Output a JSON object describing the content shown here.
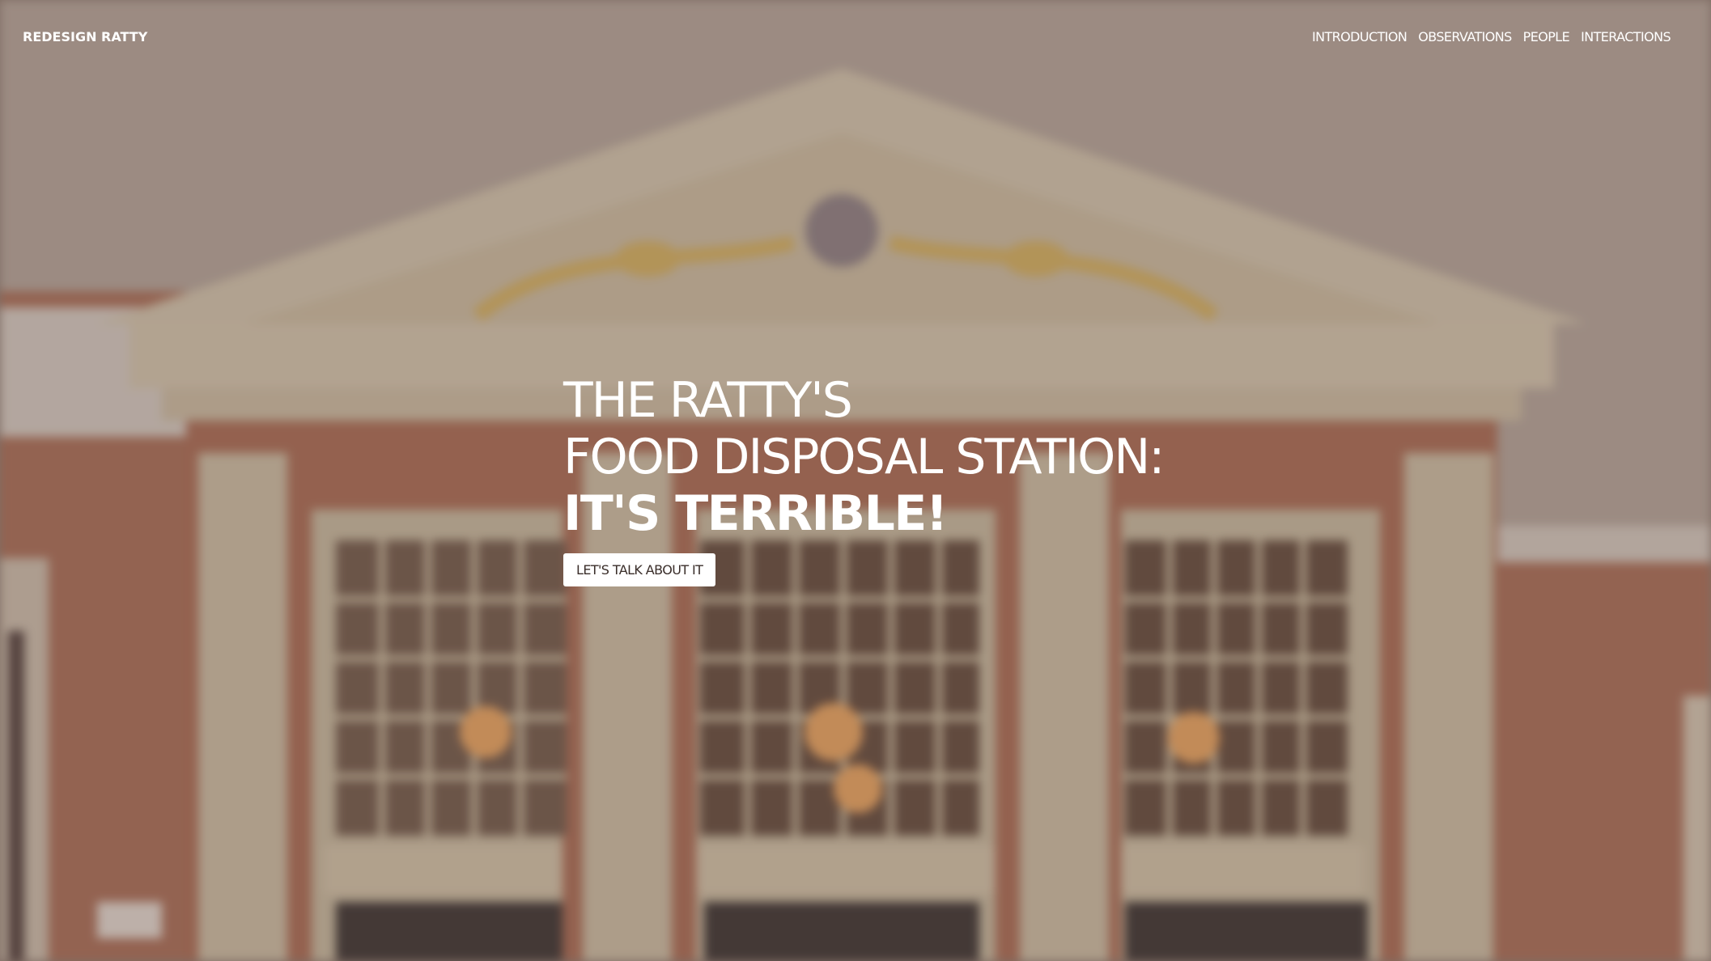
{
  "navbar": {
    "brand": "REDESIGN RATTY",
    "links": [
      {
        "label": "INTRODUCTION"
      },
      {
        "label": "OBSERVATIONS"
      },
      {
        "label": "PEOPLE"
      },
      {
        "label": "INTERACTIONS"
      }
    ]
  },
  "hero": {
    "headline_line1": "THE RATTY'S",
    "headline_line2": "FOOD DISPOSAL STATION:",
    "headline_line3": "IT'S TERRIBLE!",
    "cta_label": "LET'S TALK ABOUT IT"
  },
  "colors": {
    "text": "#ffffff",
    "button_bg": "#ffffff",
    "button_text": "#3a2e2a",
    "overlay": "#6e554b"
  },
  "icons": {
    "background": "building-facade-photo"
  }
}
